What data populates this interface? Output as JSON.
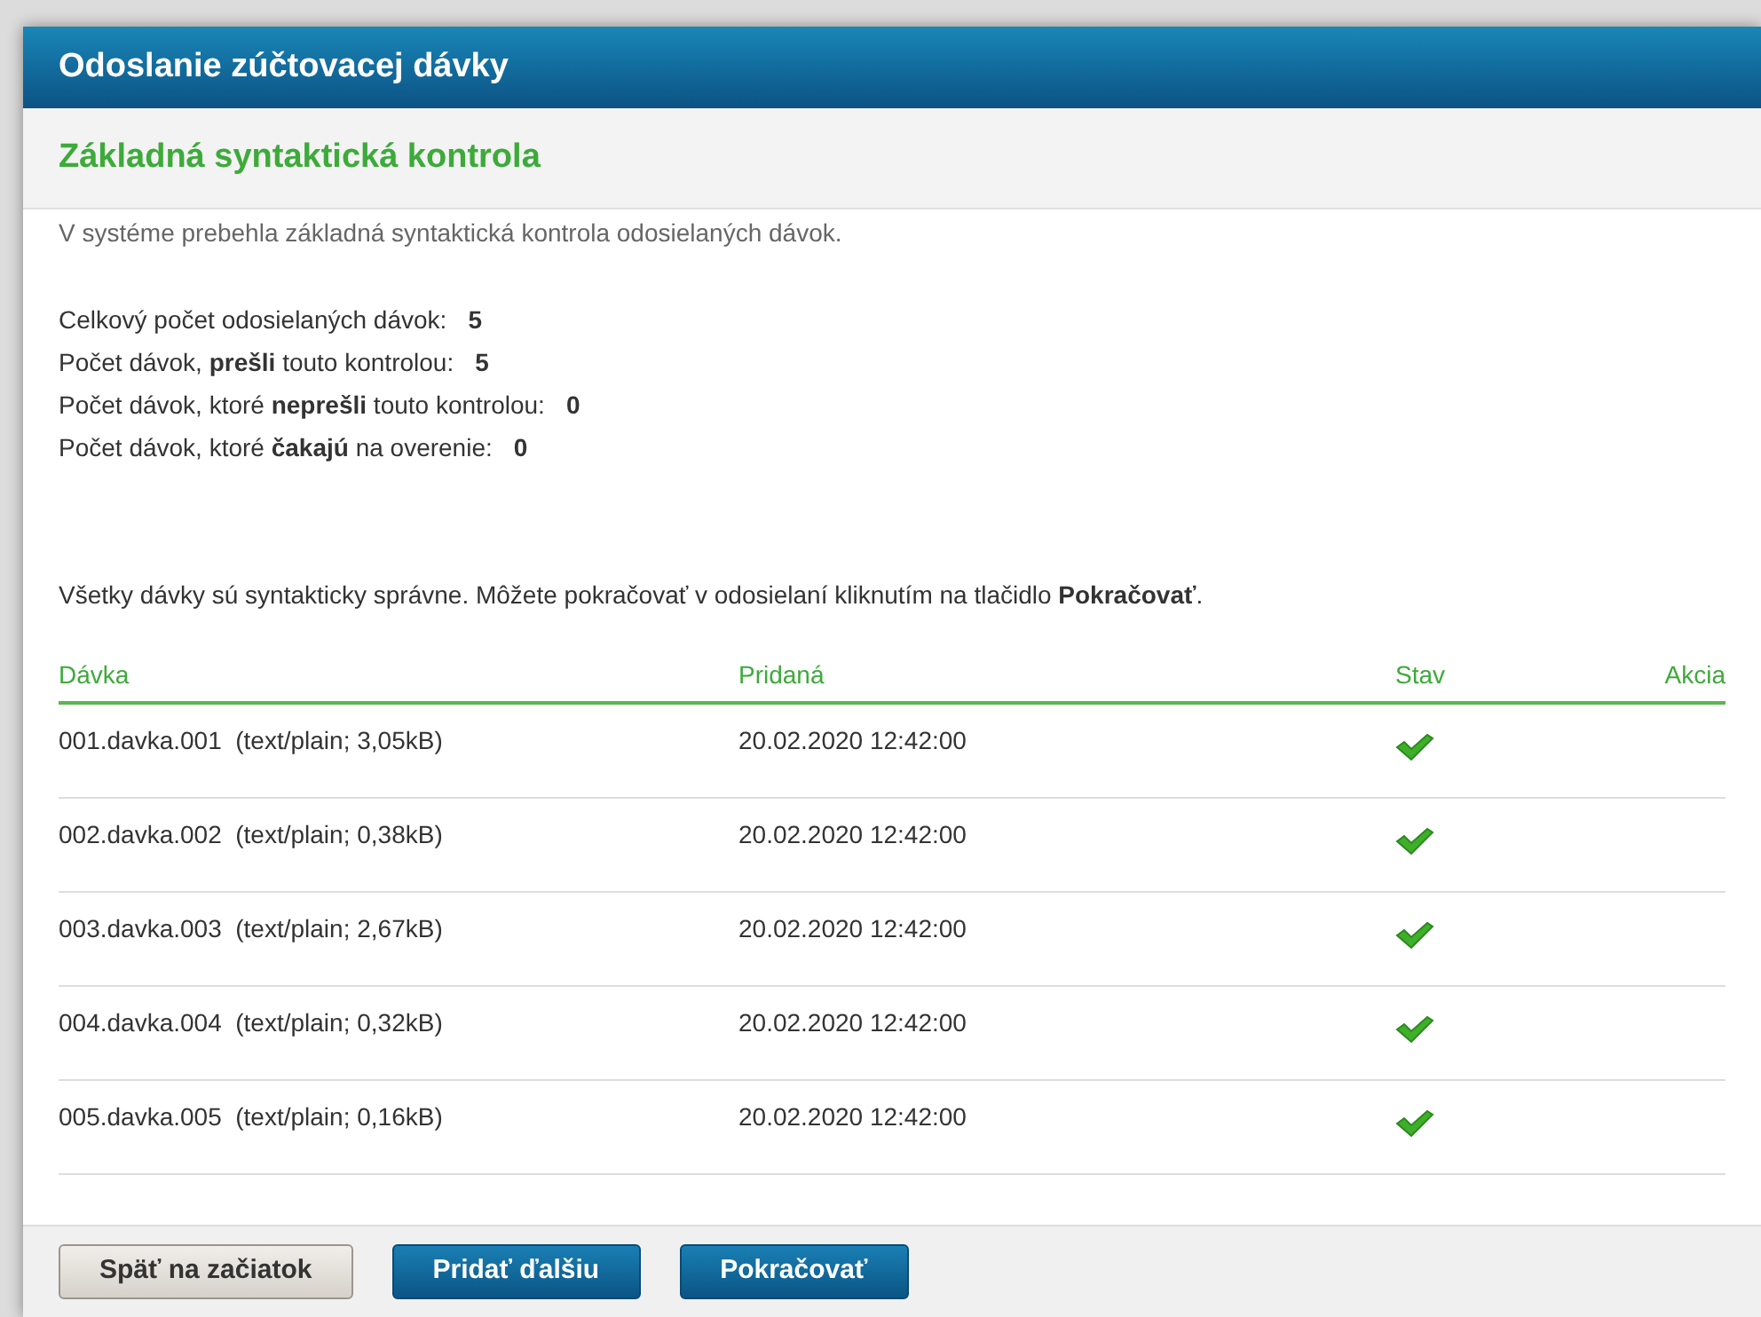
{
  "window": {
    "title": "Odoslanie zúčtovacej dávky"
  },
  "section": {
    "title": "Základná syntaktická kontrola",
    "intro": "V systéme prebehla základná syntaktická kontrola odosielaných dávok."
  },
  "stats": [
    {
      "label": "Celkový počet odosielaných dávok:",
      "value": "5"
    },
    {
      "label": "Počet dávok, **prešli** touto kontrolou:",
      "value": "5"
    },
    {
      "label": "Počet dávok, ktoré **neprešli** touto kontrolou:",
      "value": "0"
    },
    {
      "label": "Počet dávok, ktoré **čakajú** na overenie:",
      "value": "0"
    }
  ],
  "message": "Všetky dávky sú syntakticky správne. Môžete pokračovať v odosielaní kliknutím na tlačidlo **Pokračovať**.",
  "table": {
    "columns": [
      "Dávka",
      "Pridaná",
      "Stav",
      "Akcia"
    ],
    "rows": [
      {
        "file": "001.davka.001  (text/plain; 3,05kB)",
        "added": "20.02.2020 12:42:00",
        "valid": true
      },
      {
        "file": "002.davka.002  (text/plain; 0,38kB)",
        "added": "20.02.2020 12:42:00",
        "valid": true
      },
      {
        "file": "003.davka.003  (text/plain; 2,67kB)",
        "added": "20.02.2020 12:42:00",
        "valid": true
      },
      {
        "file": "004.davka.004  (text/plain; 0,32kB)",
        "added": "20.02.2020 12:42:00",
        "valid": true
      },
      {
        "file": "005.davka.005  (text/plain; 0,16kB)",
        "added": "20.02.2020 12:42:00",
        "valid": true
      }
    ]
  },
  "buttons": [
    {
      "label": "Späť na začiatok",
      "kind": "secondary"
    },
    {
      "label": "Pridať ďalšiu",
      "kind": "primary"
    },
    {
      "label": "Pokračovať",
      "kind": "primary"
    }
  ]
}
